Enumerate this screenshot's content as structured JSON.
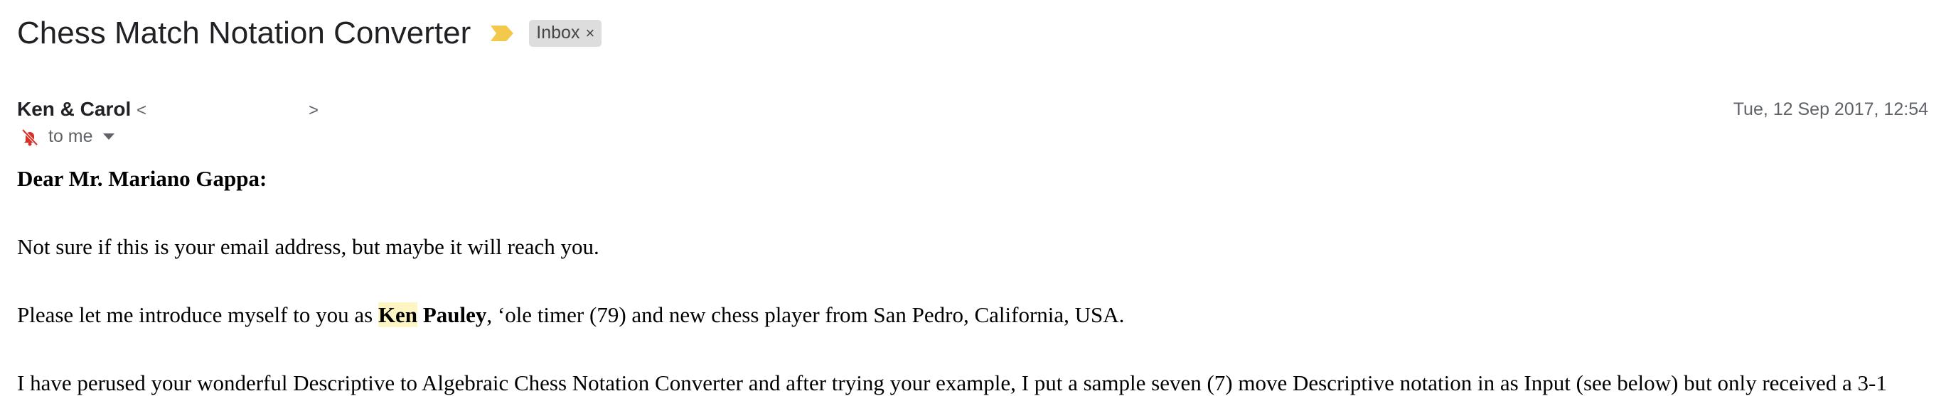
{
  "email": {
    "subject": "Chess Match Notation Converter",
    "label": {
      "text": "Inbox",
      "close_glyph": "×"
    },
    "sender": {
      "name": "Ken & Carol",
      "email_open": "<",
      "email_close": ">"
    },
    "date": "Tue, 12 Sep 2017, 12:54",
    "recipient": "to me",
    "body": {
      "greeting": "Dear Mr. Mariano Gappa:",
      "p1": "Not sure if this is your email address, but maybe it will reach you.",
      "p2_start": "Please let me introduce myself to you as ",
      "p2_name_first": "Ken",
      "p2_name_last": " Pauley",
      "p2_end": ", ‘ole timer (79) and new chess player from San Pedro, California, USA.",
      "p3": "I have perused your wonderful Descriptive to Algebraic Chess Notation Converter and after trying your example, I put a sample seven (7) move Descriptive notation in as Input (see below) but only received a 3-1"
    }
  },
  "colors": {
    "importance_marker": "#f2c94c",
    "highlight": "#fdf6c3",
    "muted_icon": "#d93025"
  },
  "icons": {
    "importance": "importance-marker-icon",
    "muted": "muted-notifications-icon",
    "dropdown": "caret-down-icon"
  }
}
